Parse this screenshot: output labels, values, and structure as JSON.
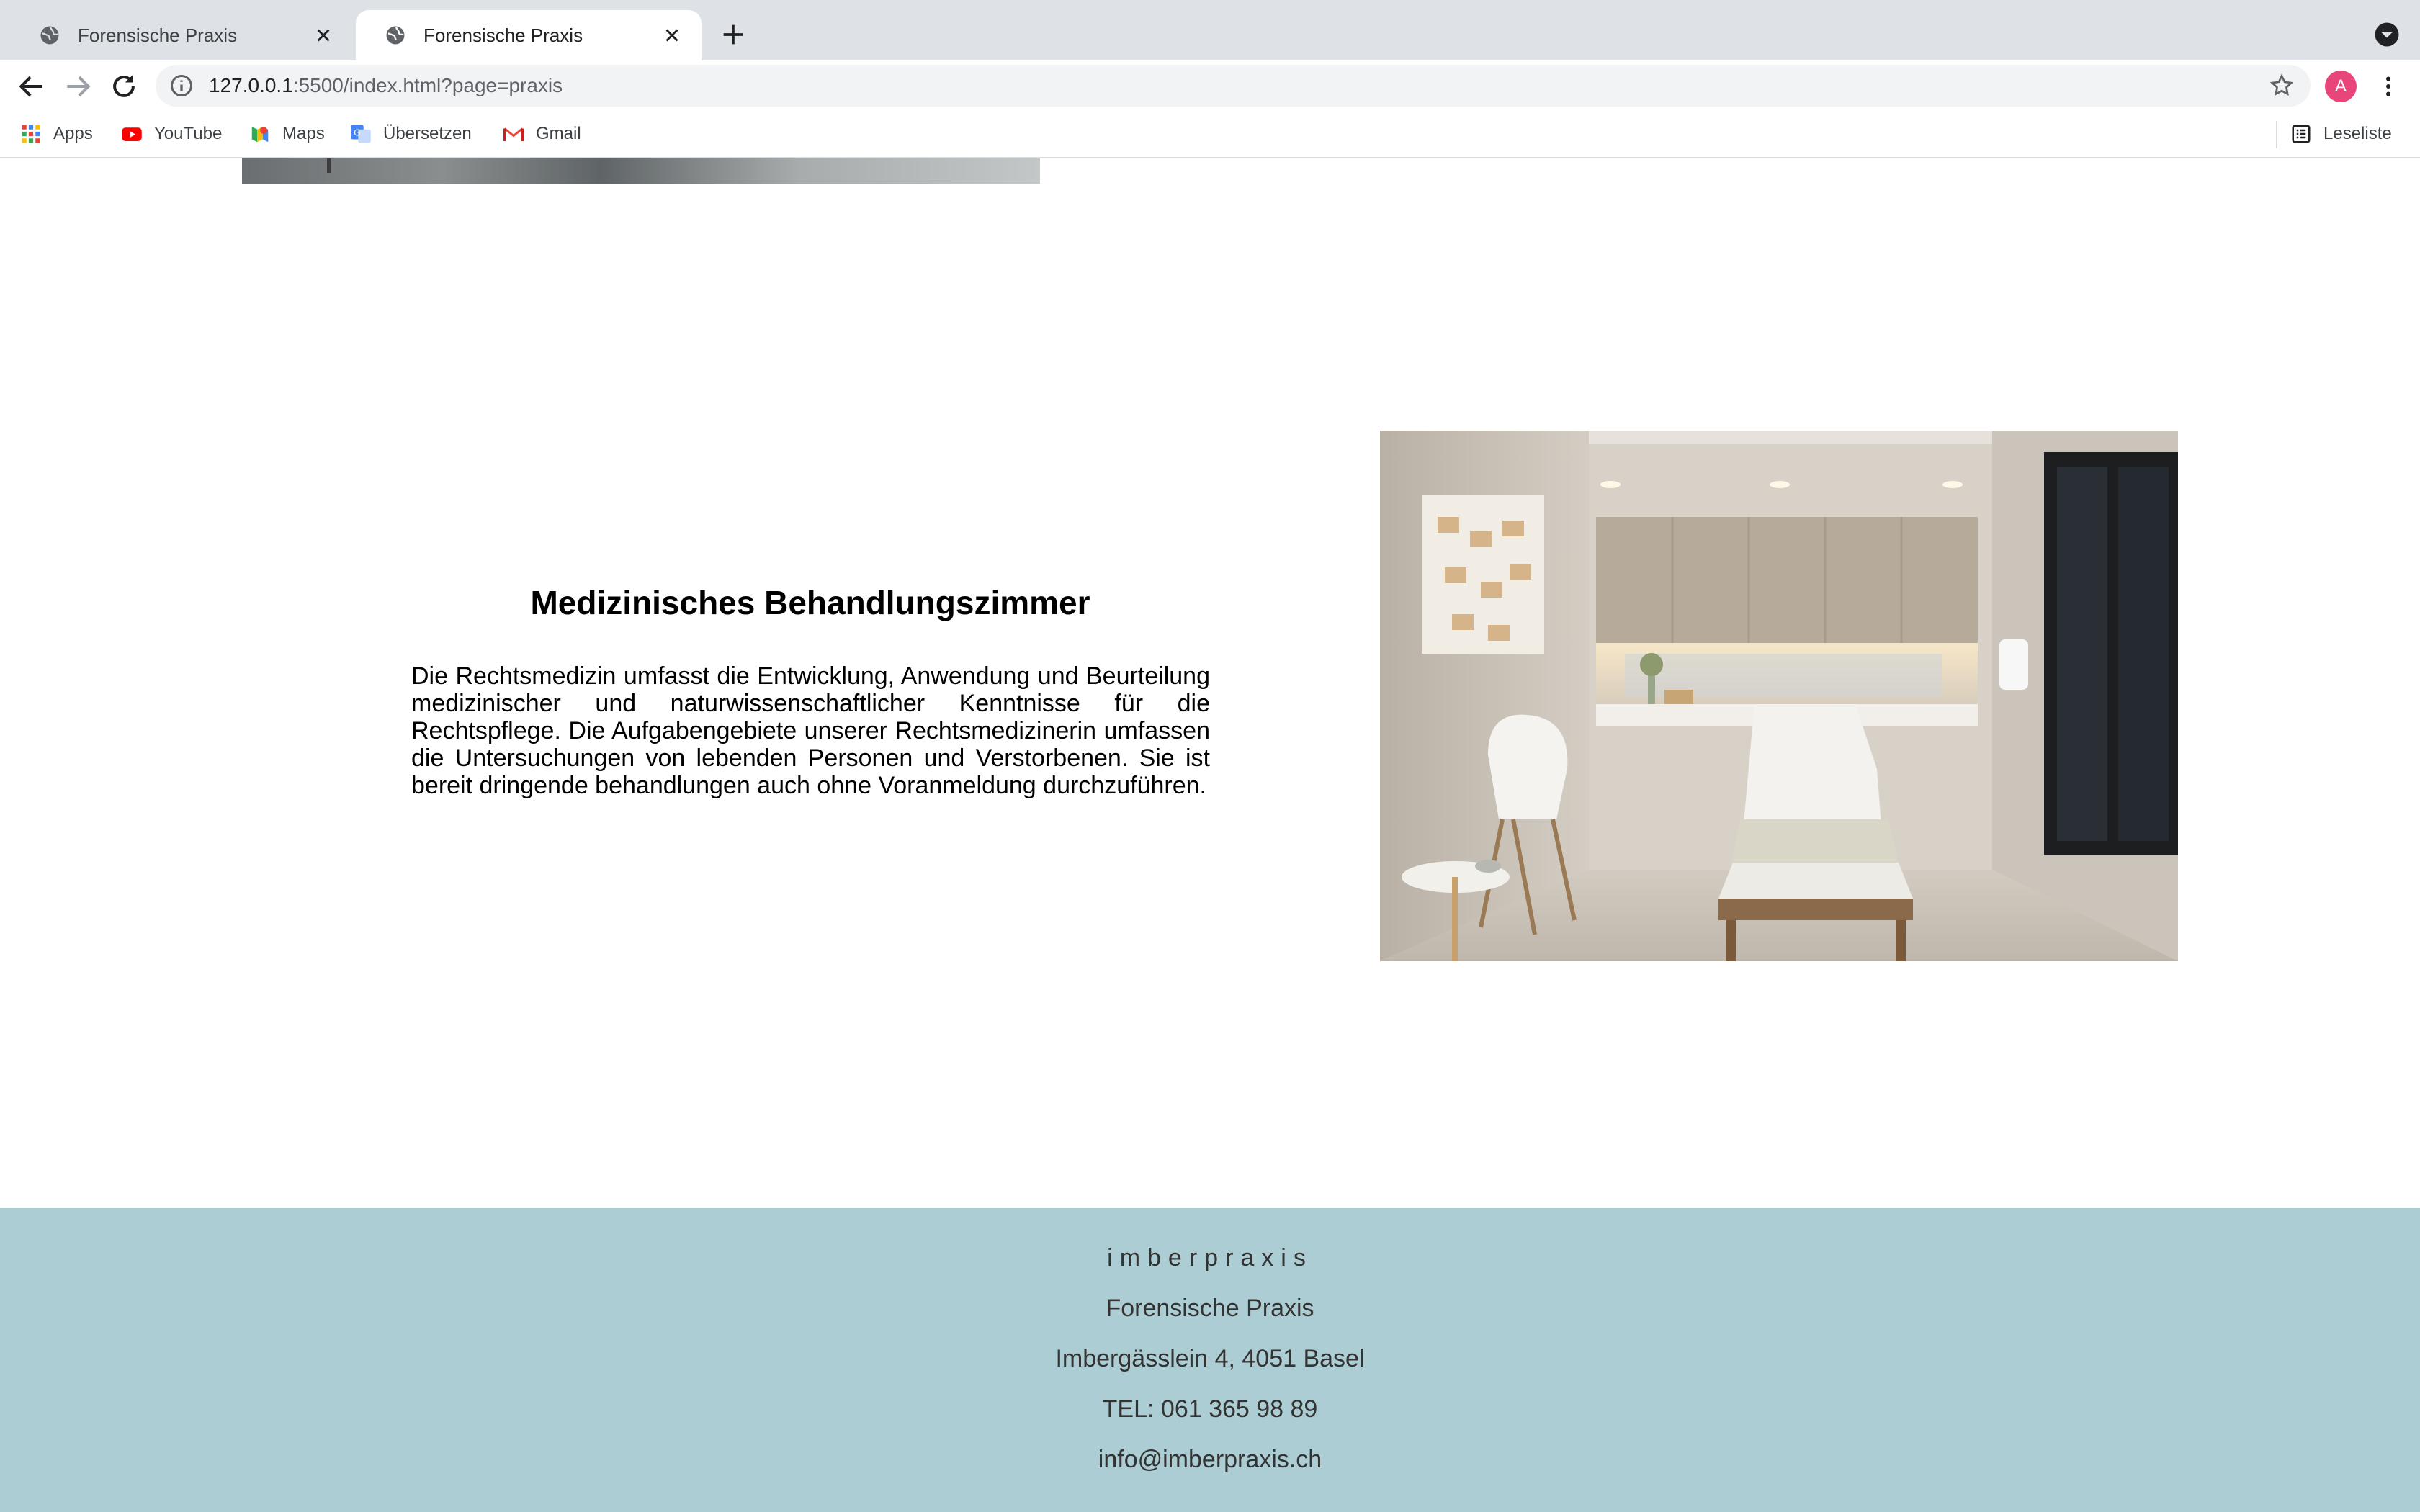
{
  "browser": {
    "tabs": [
      {
        "title": "Forensische Praxis",
        "active": false
      },
      {
        "title": "Forensische Praxis",
        "active": true
      }
    ],
    "url_host": "127.0.0.1",
    "url_rest": ":5500/index.html?page=praxis",
    "profile_initial": "A",
    "bookmarks": [
      {
        "label": "Apps",
        "icon": "apps-grid-icon"
      },
      {
        "label": "YouTube",
        "icon": "youtube-icon"
      },
      {
        "label": "Maps",
        "icon": "maps-icon"
      },
      {
        "label": "Übersetzen",
        "icon": "translate-icon"
      },
      {
        "label": "Gmail",
        "icon": "gmail-icon"
      }
    ],
    "reading_list": "Leseliste"
  },
  "section": {
    "title": "Medizinisches Behandlungszimmer",
    "text": "Die Rechtsmedizin umfasst die Entwicklung, Anwendung und Beurteilung medizinischer und naturwissenschaftlicher Kenntnisse für die Rechtspflege. Die Aufgabengebiete unserer Rechtsmedizinerin umfassen die Untersuchungen von lebenden Personen und Verstorbenen. Sie ist bereit dringende behandlungen auch ohne Voranmeldung durchzuführen."
  },
  "footer": {
    "brand": "imberpraxis",
    "name": "Forensische Praxis",
    "address": "Imbergässlein 4, 4051 Basel",
    "phone": "TEL: 061 365 98 89",
    "email": "info@imberpraxis.ch"
  },
  "colors": {
    "footer_bg": "#abcdd3",
    "avatar": "#e8457a"
  }
}
